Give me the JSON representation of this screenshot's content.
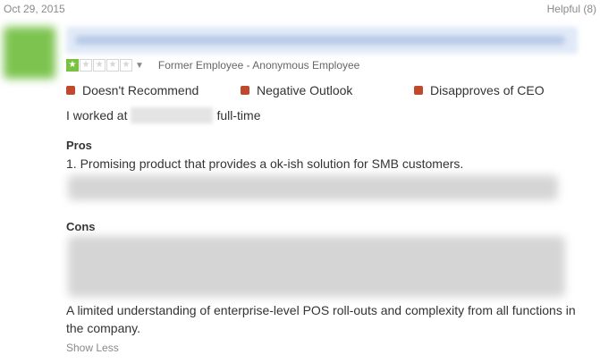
{
  "review": {
    "date": "Oct 29, 2015",
    "helpful": "Helpful (8)",
    "rating": {
      "filled_stars": 1,
      "total_stars": 5,
      "star_color": "#7ac142",
      "star_glyph": "★",
      "dropdown_glyph": "▼"
    },
    "reviewer": "Former Employee - Anonymous Employee",
    "flags": [
      {
        "label": "Doesn't Recommend",
        "color": "#c0482c"
      },
      {
        "label": "Negative Outlook",
        "color": "#c0482c"
      },
      {
        "label": "Disapproves of CEO",
        "color": "#c0482c"
      }
    ],
    "worked_prefix": "I worked at",
    "worked_suffix": "full-time",
    "pros": {
      "heading": "Pros",
      "line1": "1. Promising product that provides a ok-ish solution for SMB customers."
    },
    "cons": {
      "heading": "Cons",
      "line1": "A limited understanding of enterprise-level POS roll-outs and complexity from all functions in",
      "line2": "the company."
    },
    "show_less": "Show Less"
  }
}
